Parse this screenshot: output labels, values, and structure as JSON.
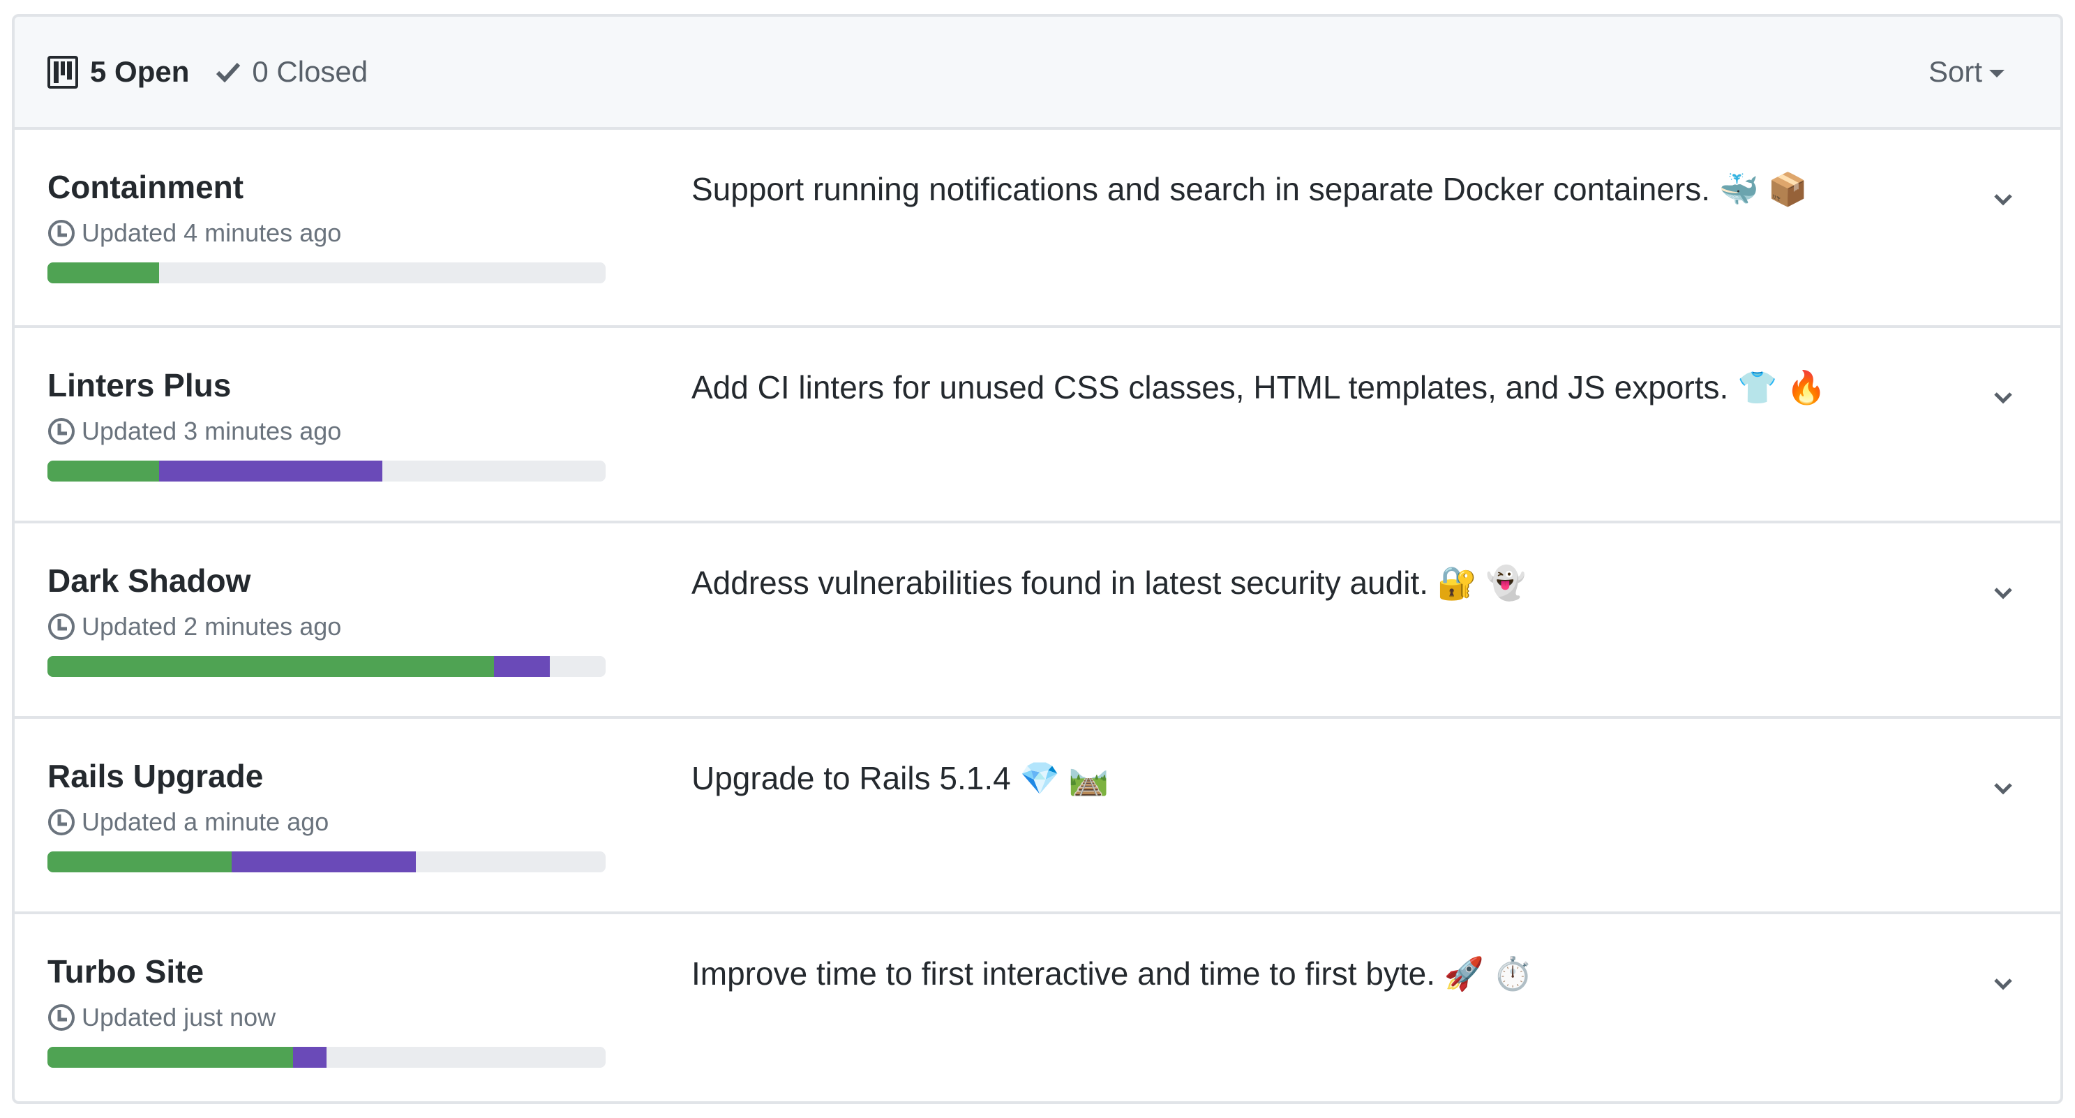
{
  "header": {
    "open_label": "5 Open",
    "closed_label": "0 Closed",
    "sort_label": "Sort",
    "icons": {
      "open": "project-icon",
      "closed": "check-icon",
      "sort": "caret-down-icon"
    }
  },
  "colors": {
    "done": "#4fa353",
    "in_progress": "#6a4ab8",
    "remaining": "#eaecef",
    "header_bg": "#f6f8fa",
    "border": "#e1e4e8"
  },
  "projects": [
    {
      "name": "Containment",
      "updated": "Updated 4 minutes ago",
      "description": "Support running notifications and search in separate Docker containers. 🐳 📦",
      "progress": {
        "done_percent": 20,
        "in_progress_percent": 0
      }
    },
    {
      "name": "Linters Plus",
      "updated": "Updated 3 minutes ago",
      "description": "Add CI linters for unused CSS classes, HTML templates, and JS exports. 👕 🔥",
      "progress": {
        "done_percent": 20,
        "in_progress_percent": 40
      }
    },
    {
      "name": "Dark Shadow",
      "updated": "Updated 2 minutes ago",
      "description": "Address vulnerabilities found in latest security audit. 🔐 👻",
      "progress": {
        "done_percent": 80,
        "in_progress_percent": 10
      }
    },
    {
      "name": "Rails Upgrade",
      "updated": "Updated a minute ago",
      "description": "Upgrade to Rails 5.1.4 💎 🛤️",
      "progress": {
        "done_percent": 33,
        "in_progress_percent": 33
      }
    },
    {
      "name": "Turbo Site",
      "updated": "Updated just now",
      "description": "Improve time to first interactive and time to first byte. 🚀 ⏱️",
      "progress": {
        "done_percent": 44,
        "in_progress_percent": 6
      }
    }
  ]
}
